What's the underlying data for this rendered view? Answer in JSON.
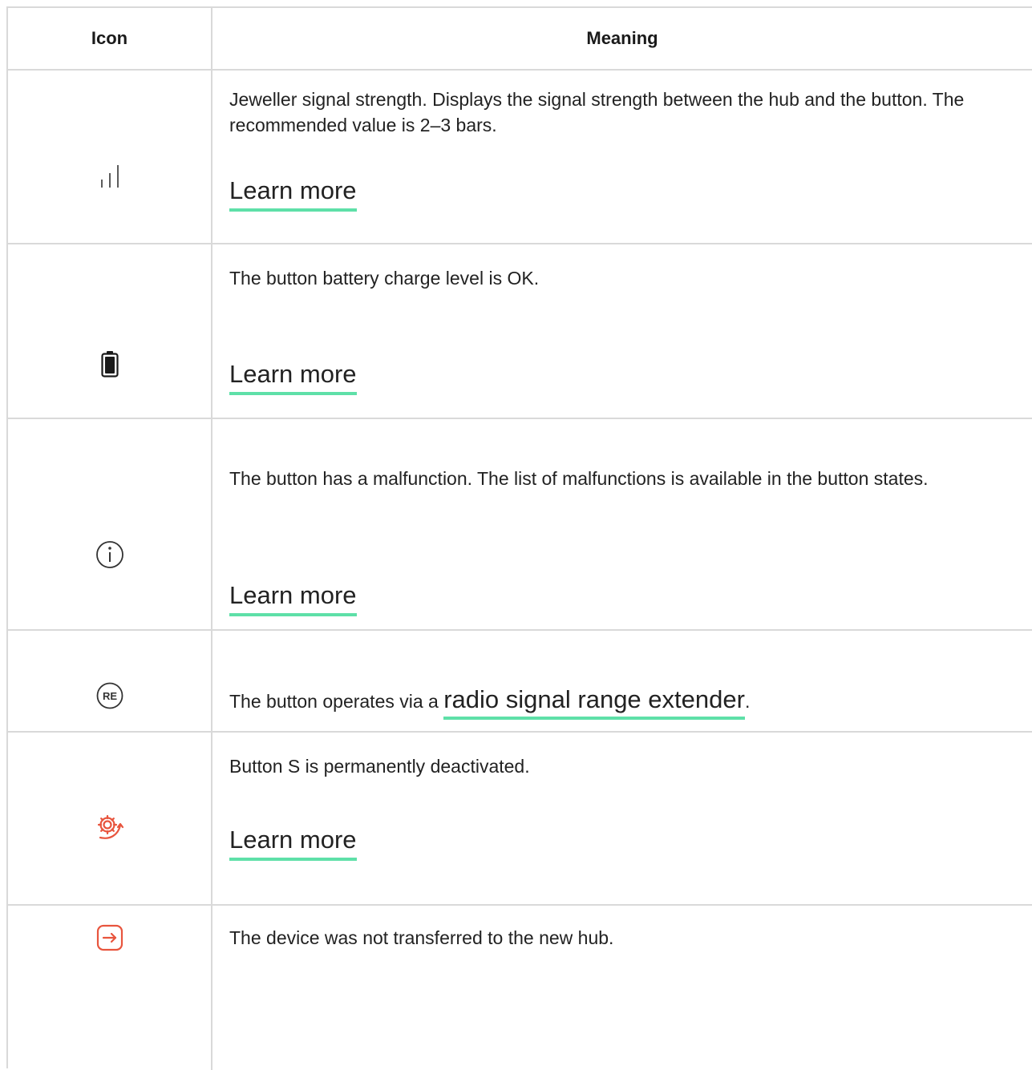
{
  "table": {
    "header": {
      "icon_col": "Icon",
      "meaning_col": "Meaning"
    },
    "rows": [
      {
        "icon": "signal-strength-icon",
        "text": "Jeweller signal strength. Displays the signal strength between the hub and the button. The recommended value is 2–3 bars.",
        "link": "Learn more"
      },
      {
        "icon": "battery-icon",
        "text": "The button battery charge level is OK.",
        "link": "Learn more"
      },
      {
        "icon": "info-icon",
        "text": "The button has a malfunction. The list of malfunctions is available in the button states.",
        "link": "Learn more"
      },
      {
        "icon": "range-extender-icon",
        "icon_text": "RE",
        "text_before": "The button operates via a ",
        "link": "radio signal range extender",
        "text_after": "."
      },
      {
        "icon": "deactivated-gear-icon",
        "text": "Button S is permanently deactivated.",
        "link": "Learn more"
      },
      {
        "icon": "transfer-arrow-icon",
        "text": "The device was not transferred to the new hub."
      }
    ]
  },
  "colors": {
    "link_underline": "#5ee0a8",
    "alert_icon": "#e8553e",
    "border": "#d9d9d9",
    "text": "#222222"
  }
}
